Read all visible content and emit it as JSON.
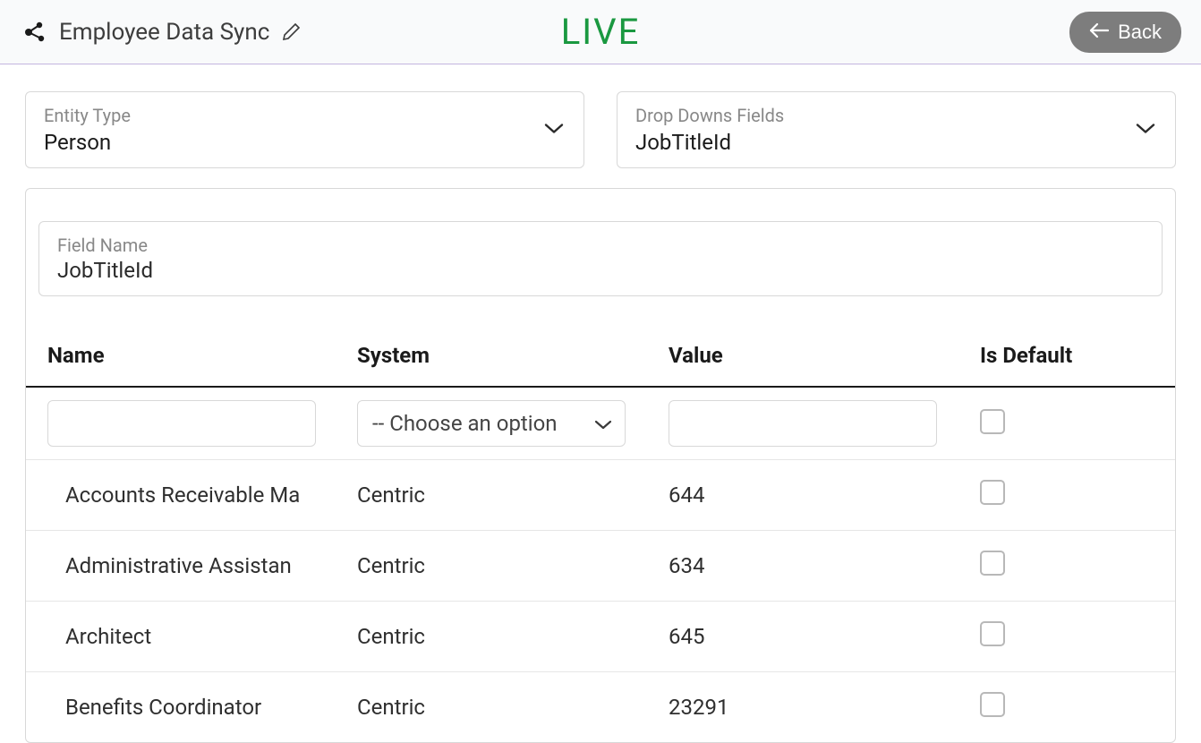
{
  "header": {
    "title": "Employee Data Sync",
    "status": "LIVE",
    "back_label": "Back"
  },
  "selectors": {
    "entity_type": {
      "label": "Entity Type",
      "value": "Person"
    },
    "dropdown_fields": {
      "label": "Drop Downs Fields",
      "value": "JobTitleId"
    }
  },
  "field_name": {
    "label": "Field Name",
    "value": "JobTitleId"
  },
  "table": {
    "headers": {
      "name": "Name",
      "system": "System",
      "value": "Value",
      "is_default": "Is Default"
    },
    "filter": {
      "system_placeholder": "-- Choose an option"
    },
    "rows": [
      {
        "name": "Accounts Receivable Ma",
        "system": "Centric",
        "value": "644",
        "is_default": false
      },
      {
        "name": "Administrative Assistan",
        "system": "Centric",
        "value": "634",
        "is_default": false
      },
      {
        "name": "Architect",
        "system": "Centric",
        "value": "645",
        "is_default": false
      },
      {
        "name": "Benefits Coordinator",
        "system": "Centric",
        "value": "23291",
        "is_default": false
      }
    ]
  }
}
